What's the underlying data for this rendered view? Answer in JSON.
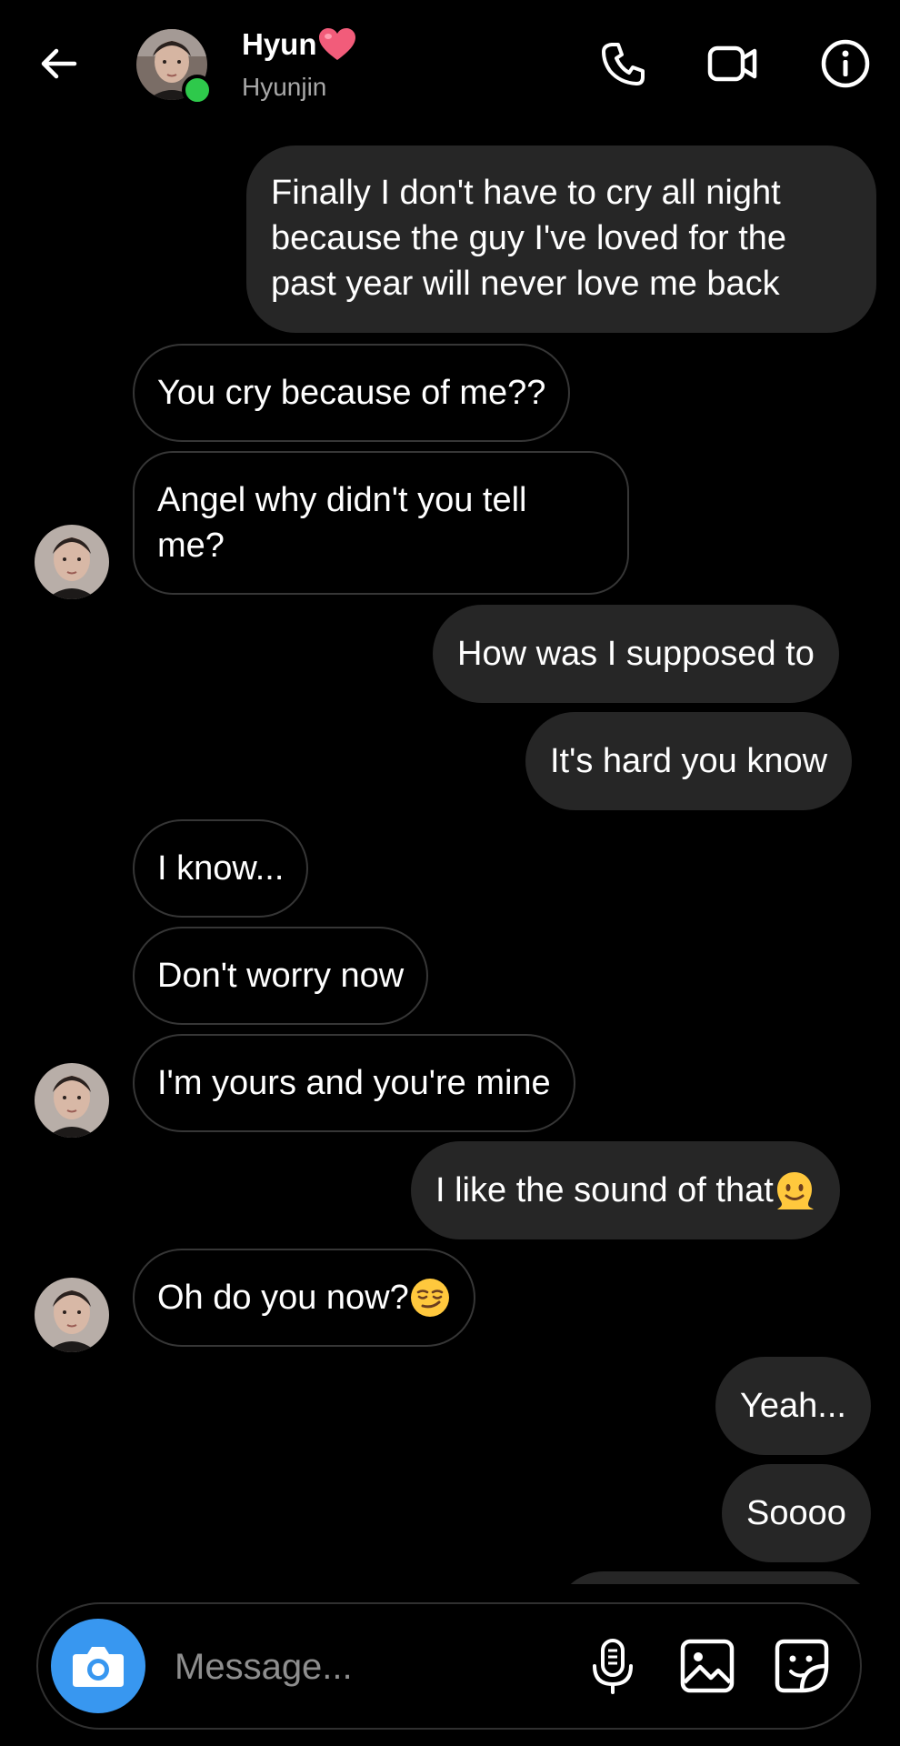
{
  "header": {
    "name": "Hyun",
    "username": "Hyunjin",
    "name_emoji_icon": "heart-icon",
    "online_color": "#2ec94b",
    "back_icon": "arrow-left-icon",
    "call_icon": "phone-icon",
    "video_icon": "video-camera-icon",
    "info_icon": "info-icon"
  },
  "messages": [
    {
      "sender": "me",
      "lines": [
        "Finally I don't have to cry all night",
        "because the guy I've loved for the",
        "past year will never love me back"
      ]
    },
    {
      "sender": "them",
      "text": "You cry because of me??"
    },
    {
      "sender": "them",
      "lines": [
        "Angel why didn't you tell",
        "me?"
      ]
    },
    {
      "sender": "me",
      "text": "How was I supposed to"
    },
    {
      "sender": "me",
      "text": "It's hard you know"
    },
    {
      "sender": "them",
      "text": "I know..."
    },
    {
      "sender": "them",
      "text": "Don't worry now"
    },
    {
      "sender": "them",
      "text": "I'm yours and you're mine"
    },
    {
      "sender": "me",
      "text": "I like the sound of that",
      "emoji": "melting-face"
    },
    {
      "sender": "them",
      "text": "Oh do you now?",
      "emoji": "smirking-face"
    },
    {
      "sender": "me",
      "text": "Yeah..."
    },
    {
      "sender": "me",
      "text": "Soooo"
    }
  ],
  "composer": {
    "placeholder": "Message...",
    "camera_icon": "camera-icon",
    "mic_icon": "microphone-icon",
    "gallery_icon": "image-icon",
    "sticker_icon": "sticker-icon",
    "accent_color": "#3897f0"
  },
  "colors": {
    "background": "#000000",
    "outgoing_bubble": "#262626",
    "incoming_border": "#363636",
    "secondary_text": "#a8a8a8"
  }
}
